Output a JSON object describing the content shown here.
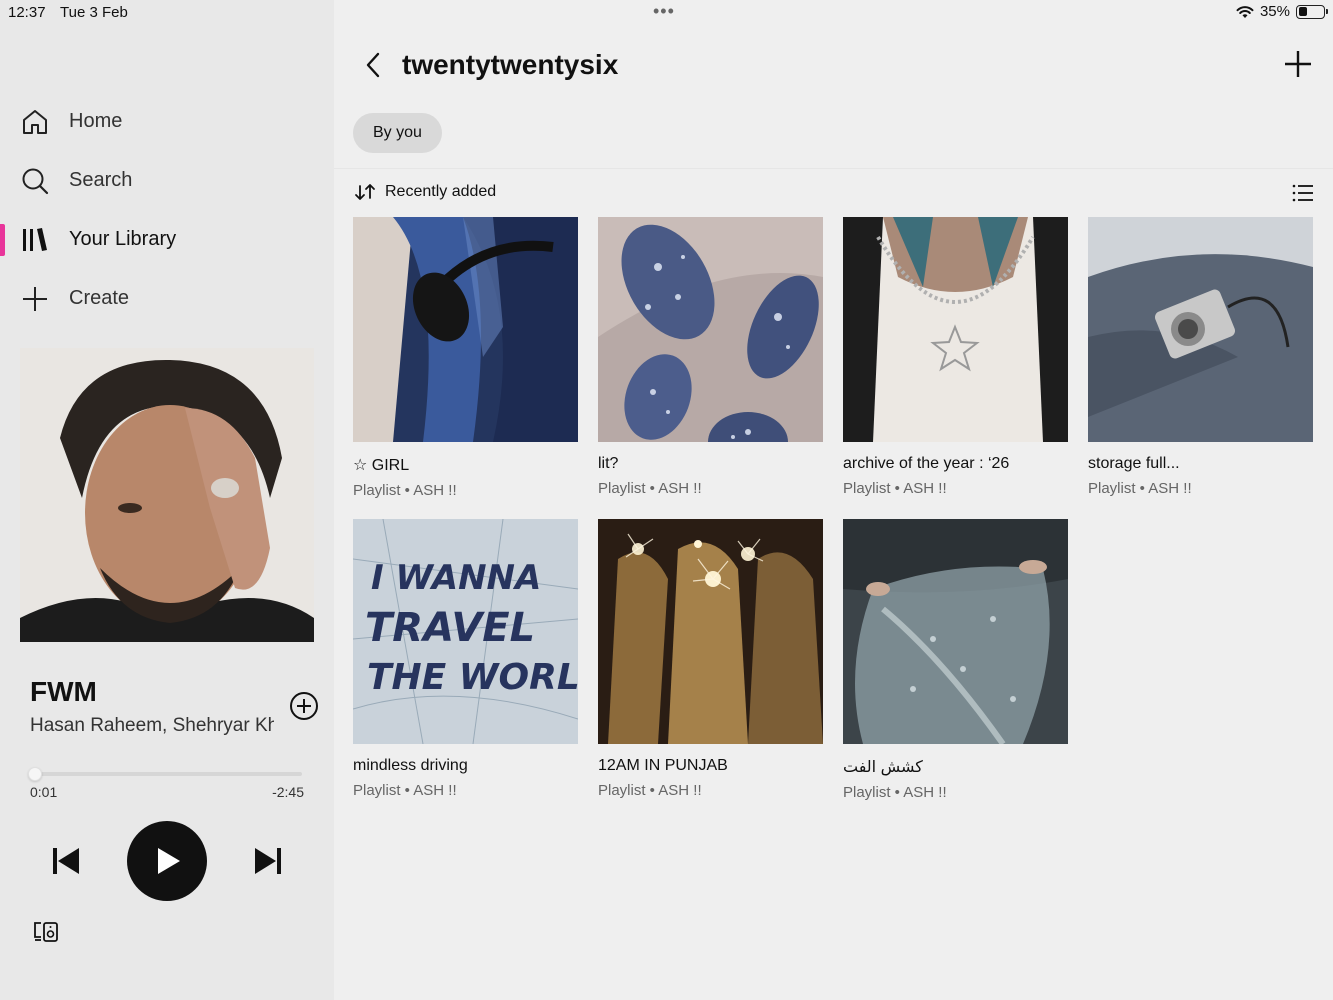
{
  "status_bar": {
    "time": "12:37",
    "date": "Tue 3 Feb",
    "battery": "35%",
    "battery_level": 0.35
  },
  "sidebar": {
    "nav": [
      {
        "label": "Home",
        "icon": "home-icon"
      },
      {
        "label": "Search",
        "icon": "search-icon"
      },
      {
        "label": "Your Library",
        "icon": "library-icon",
        "active": true
      },
      {
        "label": "Create",
        "icon": "plus-icon"
      }
    ]
  },
  "now_playing": {
    "title": "FWM",
    "artist": "Hasan Raheem, Shehryar Khan",
    "elapsed": "0:01",
    "remaining": "-2:45",
    "progress": 0.01
  },
  "folder": {
    "title": "twentytwentysix",
    "filter_chip": "By you",
    "sort_label": "Recently added"
  },
  "playlists": [
    {
      "name": "☆ GIRL",
      "subtitle": "Playlist • ASH !!"
    },
    {
      "name": "lit?",
      "subtitle": "Playlist • ASH !!"
    },
    {
      "name": "archive of the year : ‘26",
      "subtitle": "Playlist • ASH !!"
    },
    {
      "name": "storage full...",
      "subtitle": "Playlist • ASH !!"
    },
    {
      "name": "mindless driving",
      "subtitle": "Playlist • ASH !!"
    },
    {
      "name": "12AM IN PUNJAB",
      "subtitle": "Playlist • ASH !!"
    },
    {
      "name": "كشش الفت",
      "subtitle": "Playlist • ASH !!"
    }
  ],
  "art_texts": {
    "travel_lines": [
      "I WANNA",
      "TRAVEL",
      "THE WORLD"
    ]
  },
  "colors": {
    "accent": "#e8359a",
    "text": "#111111",
    "muted": "#666666",
    "sidebar_bg": "#e8e8e8",
    "main_bg": "#efefef"
  }
}
